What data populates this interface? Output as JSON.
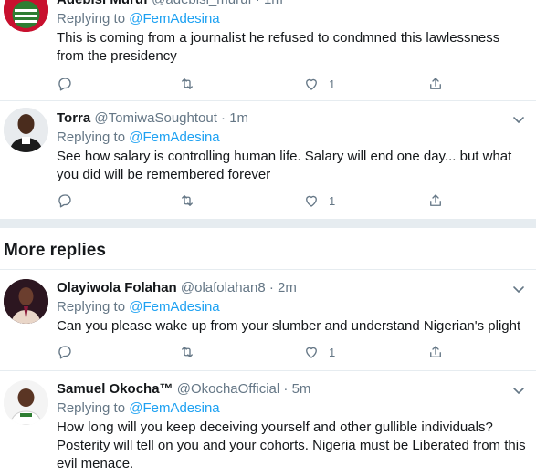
{
  "tweets": [
    {
      "name": "Adebisi Muruf",
      "handle": "@adebisi_muruf",
      "time": "1m",
      "replying_prefix": "Replying to",
      "replying_to": "@FemAdesina",
      "text": "This is coming from a journalist he refused to condmned this lawlessness from the presidency",
      "likes": "1"
    },
    {
      "name": "Torra",
      "handle": "@TomiwaSoughtout",
      "time": "1m",
      "replying_prefix": "Replying to",
      "replying_to": "@FemAdesina",
      "text": "See how salary is controlling human life. Salary will end one day... but what you did will be remembered forever",
      "likes": "1"
    },
    {
      "name": "Olayiwola Folahan",
      "handle": "@olafolahan8",
      "time": "2m",
      "replying_prefix": "Replying to",
      "replying_to": "@FemAdesina",
      "text": "Can you please wake up from your slumber and understand Nigerian's plight",
      "likes": "1"
    },
    {
      "name": "Samuel Okocha™",
      "handle": "@OkochaOfficial",
      "time": "5m",
      "replying_prefix": "Replying to",
      "replying_to": "@FemAdesina",
      "text": "How long will you keep deceiving yourself and other gullible individuals? Posterity will tell on you and your cohorts. Nigeria must be Liberated from this evil menace.",
      "likes": ""
    }
  ],
  "section_title": "More replies",
  "colors": {
    "accent": "#1da1f2",
    "muted": "#657786",
    "divider": "#e6ecf0"
  }
}
